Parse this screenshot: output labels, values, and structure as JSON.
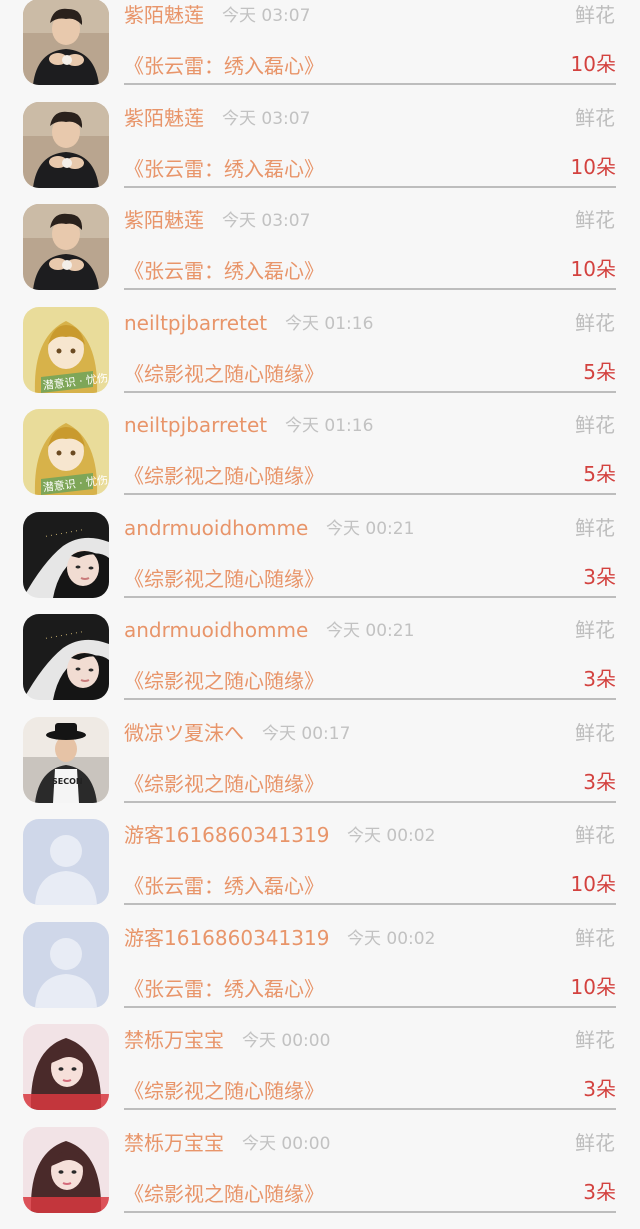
{
  "rows": [
    {
      "avatar": "man-dark-avatar",
      "name": "紫陌魅莲",
      "time": "今天 03:07",
      "gift_label": "鲜花",
      "book": "《张云雷：绣入磊心》",
      "count": "10朵"
    },
    {
      "avatar": "man-dark-avatar",
      "name": "紫陌魅莲",
      "time": "今天 03:07",
      "gift_label": "鲜花",
      "book": "《张云雷：绣入磊心》",
      "count": "10朵"
    },
    {
      "avatar": "man-dark-avatar",
      "name": "紫陌魅莲",
      "time": "今天 03:07",
      "gift_label": "鲜花",
      "book": "《张云雷：绣入磊心》",
      "count": "10朵"
    },
    {
      "avatar": "anime-girl-avatar",
      "name": "neiltpjbarretet",
      "time": "今天 01:16",
      "gift_label": "鲜花",
      "book": "《综影视之随心随缘》",
      "count": "5朵"
    },
    {
      "avatar": "anime-girl-avatar",
      "name": "neiltpjbarretet",
      "time": "今天 01:16",
      "gift_label": "鲜花",
      "book": "《综影视之随心随缘》",
      "count": "5朵"
    },
    {
      "avatar": "dark-hair-girl-avatar",
      "name": "andrmuoidhomme",
      "time": "今天 00:21",
      "gift_label": "鲜花",
      "book": "《综影视之随心随缘》",
      "count": "3朵"
    },
    {
      "avatar": "dark-hair-girl-avatar",
      "name": "andrmuoidhomme",
      "time": "今天 00:21",
      "gift_label": "鲜花",
      "book": "《综影视之随心随缘》",
      "count": "3朵"
    },
    {
      "avatar": "hat-boy-avatar",
      "name": "微凉ツ夏沫へ",
      "time": "今天 00:17",
      "gift_label": "鲜花",
      "book": "《综影视之随心随缘》",
      "count": "3朵"
    },
    {
      "avatar": "default-user-avatar",
      "name": "游客1616860341319",
      "time": "今天 00:02",
      "gift_label": "鲜花",
      "book": "《张云雷：绣入磊心》",
      "count": "10朵"
    },
    {
      "avatar": "default-user-avatar",
      "name": "游客1616860341319",
      "time": "今天 00:02",
      "gift_label": "鲜花",
      "book": "《张云雷：绣入磊心》",
      "count": "10朵"
    },
    {
      "avatar": "pink-girl-avatar",
      "name": "禁栎万宝宝",
      "time": "今天 00:00",
      "gift_label": "鲜花",
      "book": "《综影视之随心随缘》",
      "count": "3朵"
    },
    {
      "avatar": "pink-girl-avatar",
      "name": "禁栎万宝宝",
      "time": "今天 00:00",
      "gift_label": "鲜花",
      "book": "《综影视之随心随缘》",
      "count": "3朵"
    }
  ],
  "colors": {
    "name": "#e8956a",
    "time": "#c2c2c2",
    "gift_label": "#bdbdbd",
    "count": "#d3423f",
    "divider": "#bdbdbd",
    "background": "#f7f7f7"
  }
}
